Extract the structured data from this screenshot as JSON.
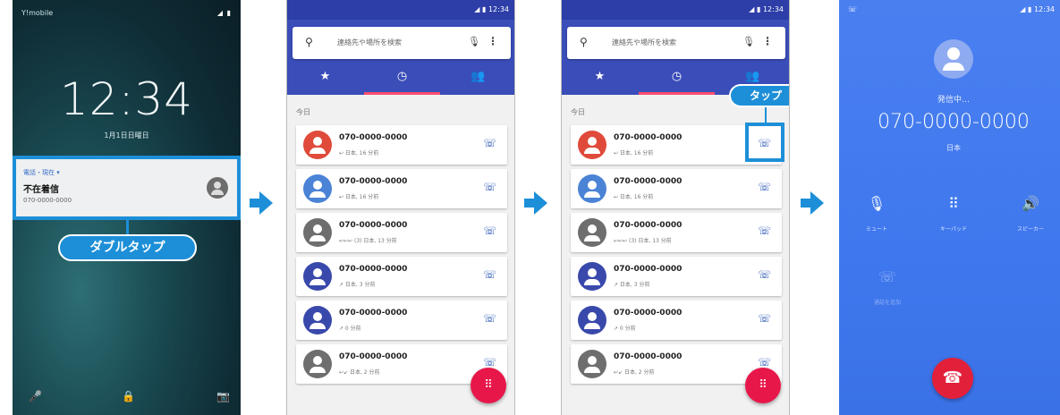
{
  "colors": {
    "accent": "#1d8fd8",
    "header_blue": "#3a4db8",
    "fab_pink": "#e8174a",
    "call_bg": "#4a7ff0",
    "end_red": "#e3203a"
  },
  "lock_screen": {
    "carrier": "Y!mobile",
    "signal": "◢ ▮",
    "time": "12:34",
    "date": "1月1日日曜日",
    "notification": {
      "app": "電話・現在 ▾",
      "title": "不在着信",
      "number": "070-0000-0000"
    },
    "callout": "ダブルタップ",
    "bottom_icons": [
      "mic-icon",
      "lock-icon",
      "camera-icon"
    ]
  },
  "call_log": {
    "status_time": "◢ ▮ 12:34",
    "search_placeholder": "連絡先や場所を検索",
    "tabs": [
      "★",
      "◷",
      "👥"
    ],
    "section_label": "今日",
    "entries": [
      {
        "number": "070-0000-0000",
        "meta": "↩ 日本, 16 分前",
        "color": "#e04a3a"
      },
      {
        "number": "070-0000-0000",
        "meta": "↩ 日本, 16 分前",
        "color": "#4b84d6"
      },
      {
        "number": "070-0000-0000",
        "meta": "↩↩↩ (3) 日本, 13 分前",
        "color": "#6e6e6e"
      },
      {
        "number": "070-0000-0000",
        "meta": "↗ 日本, 3 分前",
        "color": "#3949ab"
      },
      {
        "number": "070-0000-0000",
        "meta": "↗ 0 分前",
        "color": "#3949ab"
      },
      {
        "number": "070-0000-0000",
        "meta": "↩↙ 日本, 2 分前",
        "color": "#6e6e6e"
      }
    ],
    "fab_icon": "dialpad-icon",
    "tap_callout": "タップ"
  },
  "calling": {
    "status_left": "☏",
    "status_right": "◢ ▮ 12:34",
    "state": "発信中…",
    "number": "070-0000-0000",
    "country": "日本",
    "controls": [
      {
        "icon": "mute-icon",
        "glyph": "🎙",
        "label": "ミュート"
      },
      {
        "icon": "keypad-icon",
        "glyph": "⠿",
        "label": "キーパッド"
      },
      {
        "icon": "speaker-icon",
        "glyph": "🔊",
        "label": "スピーカー"
      }
    ],
    "add_call_label": "通話を追加"
  }
}
